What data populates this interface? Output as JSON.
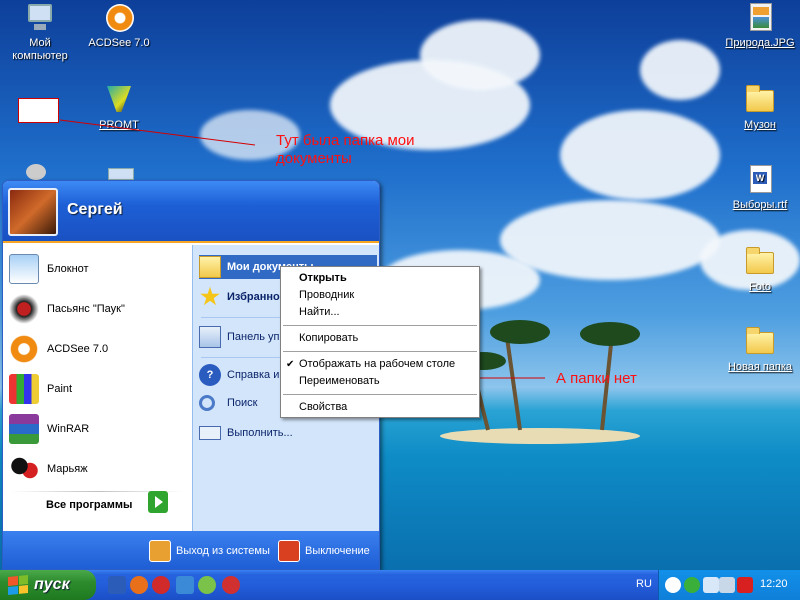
{
  "desktop": {
    "icons": [
      {
        "label": "Мой компьютер",
        "icon": "my-computer-icon"
      },
      {
        "label": "ACDSee 7.0",
        "icon": "acdsee-icon"
      },
      {
        "label": "PROMT",
        "icon": "promt-icon"
      },
      {
        "label": "Природа.JPG",
        "icon": "jpg-file-icon"
      },
      {
        "label": "Музон",
        "icon": "folder-icon"
      },
      {
        "label": "Выборы.rtf",
        "icon": "rtf-document-icon"
      },
      {
        "label": "Foto",
        "icon": "folder-icon"
      },
      {
        "label": "Новая папка",
        "icon": "folder-icon"
      }
    ]
  },
  "annotations": {
    "was_folder": "Тут была папка мои документы",
    "gone": "А папки нет"
  },
  "start_menu": {
    "user_name": "Сергей",
    "pinned": [
      {
        "label": "Блокнот",
        "icon": "notepad-icon"
      },
      {
        "label": "Пасьянс \"Паук\"",
        "icon": "spider-solitaire-icon"
      },
      {
        "label": "ACDSee 7.0",
        "icon": "acdsee-icon"
      },
      {
        "label": "Paint",
        "icon": "paint-icon"
      },
      {
        "label": "WinRAR",
        "icon": "winrar-icon"
      },
      {
        "label": "Марьяж",
        "icon": "cards-icon"
      }
    ],
    "all_programs": "Все программы",
    "right": [
      {
        "label": "Мои документы",
        "icon": "my-documents-icon"
      },
      {
        "label": "Избранное",
        "icon": "favorites-star-icon"
      },
      {
        "label": "Панель управления",
        "icon": "control-panel-icon"
      },
      {
        "label": "Справка и поддержка",
        "icon": "help-icon"
      },
      {
        "label": "Поиск",
        "icon": "search-icon"
      },
      {
        "label": "Выполнить...",
        "icon": "run-icon"
      }
    ],
    "logoff": "Выход из системы",
    "shutdown": "Выключение"
  },
  "context_menu": {
    "items": [
      "Открыть",
      "Проводник",
      "Найти...",
      "Копировать",
      "Отображать на рабочем столе",
      "Переименовать",
      "Свойства"
    ],
    "checked_item": "Отображать на рабочем столе"
  },
  "taskbar": {
    "start_label": "пуск",
    "language": "RU",
    "clock": "12:20"
  },
  "colors": {
    "annotation": "#ff1010",
    "taskbar": "#245edb",
    "start_button": "#2d8b2d",
    "menu_highlight": "#316ac5"
  }
}
